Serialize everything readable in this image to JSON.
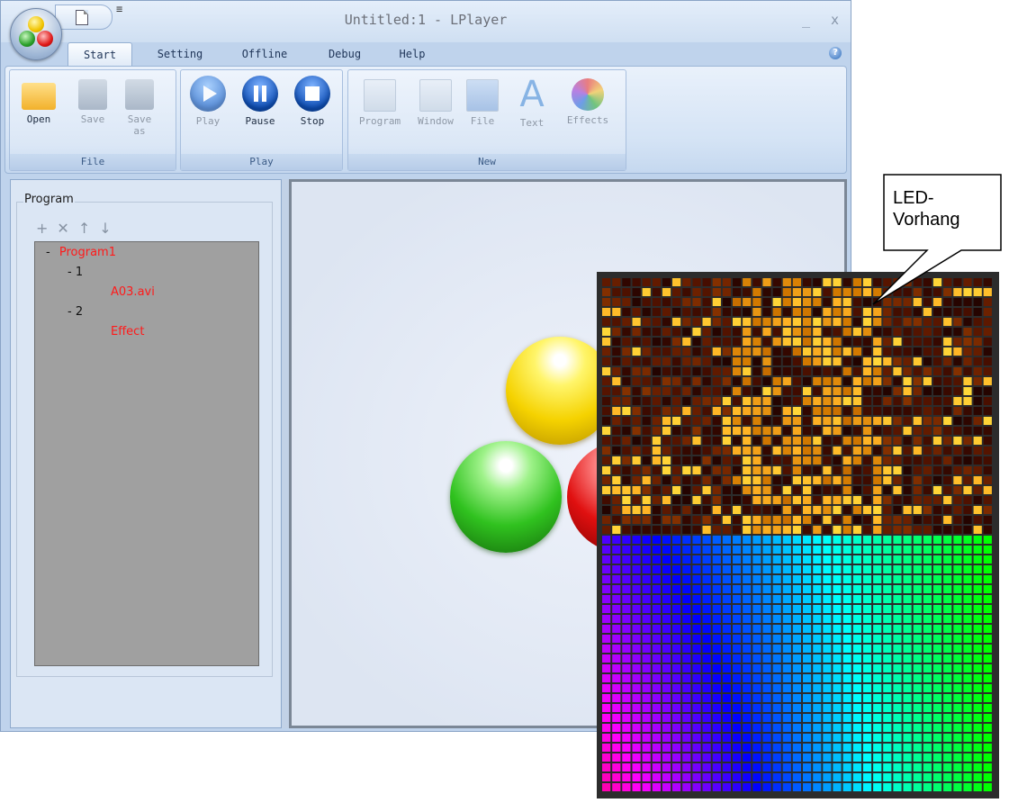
{
  "window": {
    "title": "Untitled:1 - LPlayer",
    "minimize_label": "_",
    "close_label": "x"
  },
  "quick_access": {
    "more_label": "≡"
  },
  "tabs": [
    {
      "label": "Start",
      "active": true
    },
    {
      "label": "Setting",
      "active": false
    },
    {
      "label": "Offline",
      "active": false
    },
    {
      "label": "Debug",
      "active": false
    },
    {
      "label": "Help",
      "active": false
    }
  ],
  "help_button": {
    "icon": "help-icon",
    "glyph": "?"
  },
  "ribbon": {
    "groups": [
      {
        "name": "File",
        "buttons": [
          {
            "label": "Open",
            "icon": "open-folder-icon",
            "enabled": true
          },
          {
            "label": "Save",
            "icon": "save-icon",
            "enabled": false
          },
          {
            "label": "Save as",
            "icon": "save-as-icon",
            "enabled": false
          }
        ]
      },
      {
        "name": "Play",
        "buttons": [
          {
            "label": "Play",
            "icon": "play-icon",
            "enabled": false
          },
          {
            "label": "Pause",
            "icon": "pause-icon",
            "enabled": true
          },
          {
            "label": "Stop",
            "icon": "stop-icon",
            "enabled": true
          }
        ]
      },
      {
        "name": "New",
        "buttons": [
          {
            "label": "Program",
            "icon": "new-program-icon",
            "enabled": false
          },
          {
            "label": "Window",
            "icon": "new-window-icon",
            "enabled": false
          },
          {
            "label": "File",
            "icon": "new-file-icon",
            "enabled": false
          },
          {
            "label": "Text",
            "icon": "new-text-icon",
            "enabled": false
          },
          {
            "label": "Effects",
            "icon": "effects-icon",
            "enabled": false
          }
        ]
      }
    ]
  },
  "program_panel": {
    "legend": "Program",
    "toolbar": [
      {
        "icon": "add-icon",
        "glyph": "+"
      },
      {
        "icon": "delete-icon",
        "glyph": "✕"
      },
      {
        "icon": "move-up-icon",
        "glyph": "↑"
      },
      {
        "icon": "move-down-icon",
        "glyph": "↓"
      }
    ],
    "tree": [
      {
        "toggle": "-",
        "label": "Program1",
        "color": "#ff1a1a"
      },
      {
        "toggle": "- 1",
        "label": "",
        "color": "#111111"
      },
      {
        "toggle": "",
        "label": "A03.avi",
        "color": "#ff1a1a"
      },
      {
        "toggle": "- 2",
        "label": "",
        "color": "#111111"
      },
      {
        "toggle": "",
        "label": "Effect",
        "color": "#ff1a1a"
      }
    ]
  },
  "callout": {
    "line1": "LED-",
    "line2": "Vorhang"
  },
  "colors": {
    "accent": "#1f3558",
    "tree_bg": "#a0a0a0",
    "tree_red": "#ff1a1a",
    "led_frame": "#2c2c2c"
  }
}
